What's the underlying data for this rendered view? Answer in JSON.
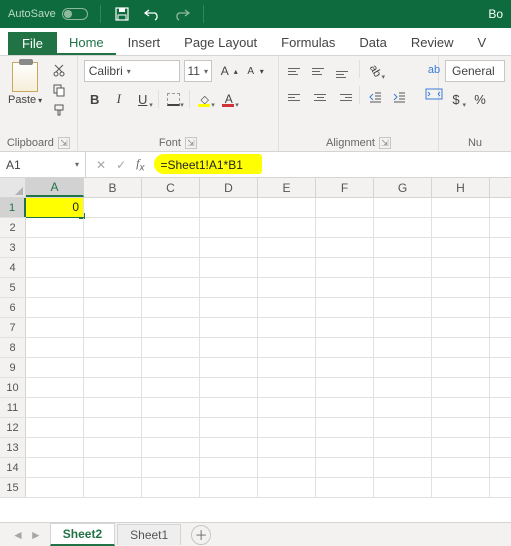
{
  "titlebar": {
    "autosave": "AutoSave",
    "doc_right": "Bo"
  },
  "tabs": {
    "file": "File",
    "home": "Home",
    "insert": "Insert",
    "pagelayout": "Page Layout",
    "formulas": "Formulas",
    "data": "Data",
    "review": "Review",
    "v": "V"
  },
  "ribbon": {
    "clipboard": {
      "paste": "Paste",
      "label": "Clipboard"
    },
    "font": {
      "name": "Calibri",
      "size": "11",
      "bold": "B",
      "italic": "I",
      "underline": "U",
      "grow": "A",
      "shrink": "A",
      "fill": "A",
      "color": "A",
      "label": "Font"
    },
    "alignment": {
      "wrap": "ab",
      "label": "Alignment"
    },
    "number": {
      "format": "General",
      "currency": "$",
      "percent": "%",
      "label": "Nu"
    }
  },
  "namebox": "A1",
  "formula": "=Sheet1!A1*B1",
  "columns": [
    "A",
    "B",
    "C",
    "D",
    "E",
    "F",
    "G",
    "H"
  ],
  "rows": [
    "1",
    "2",
    "3",
    "4",
    "5",
    "6",
    "7",
    "8",
    "9",
    "10",
    "11",
    "12",
    "13",
    "14",
    "15"
  ],
  "cells": {
    "A1": "0"
  },
  "sheets": {
    "active": "Sheet2",
    "other": "Sheet1"
  }
}
